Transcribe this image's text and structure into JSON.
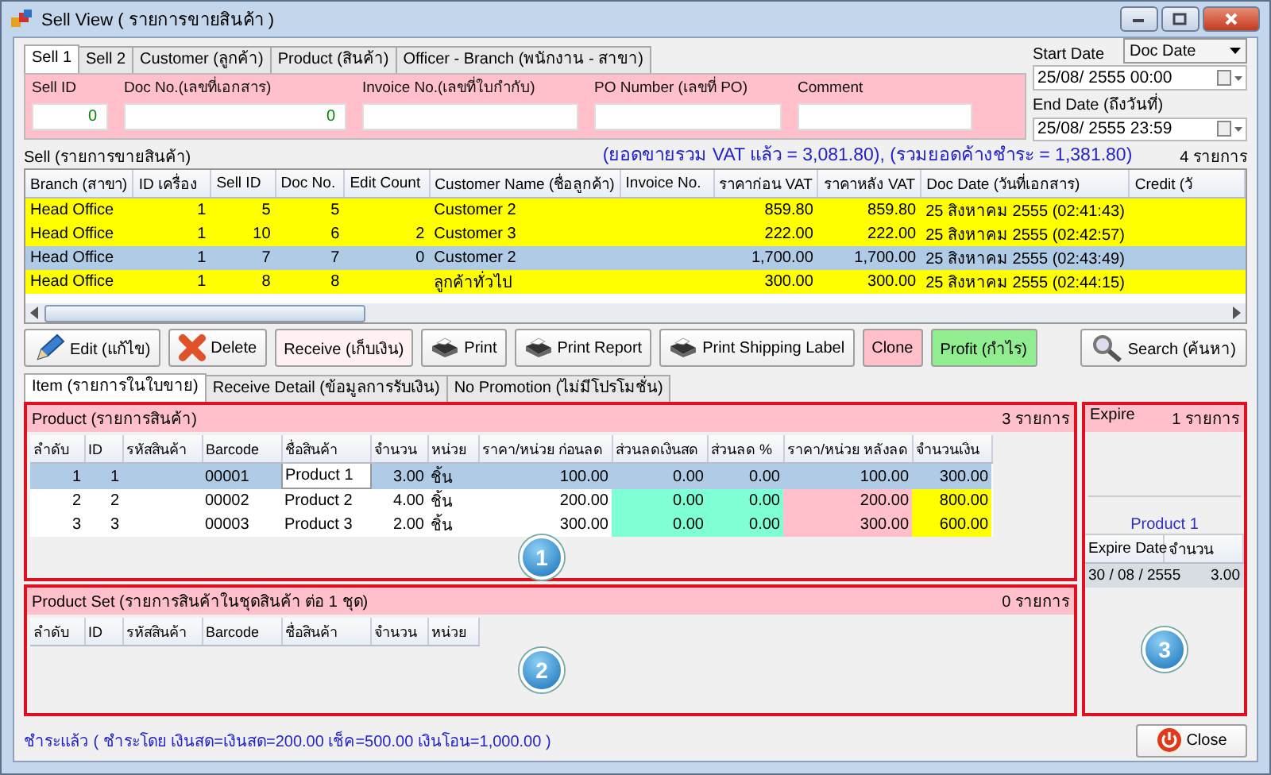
{
  "window": {
    "title": "Sell View ( รายการขายสินค้า )"
  },
  "tabs": [
    {
      "label": "Sell 1",
      "selected": true
    },
    {
      "label": "Sell 2",
      "selected": false
    },
    {
      "label": "Customer (ลูกค้า)",
      "selected": false
    },
    {
      "label": "Product (สินค้า)",
      "selected": false
    },
    {
      "label": "Officer - Branch (พนักงาน - สาขา)",
      "selected": false
    }
  ],
  "fields": [
    {
      "label": "Sell ID",
      "value": "0"
    },
    {
      "label": "Doc No.(เลขที่เอกสาร)",
      "value": "0"
    },
    {
      "label": "Invoice No.(เลขที่ใบกำกับ)"
    },
    {
      "label": "PO Number (เลขที่ PO)"
    },
    {
      "label": "Comment"
    }
  ],
  "date_filter": {
    "start_label": "Start Date",
    "mode": "Doc Date",
    "start": "25/08/  2555 00:00",
    "end_label": "End Date (ถึงวันที่)",
    "end": "25/08/  2555 23:59"
  },
  "sell": {
    "title": "Sell (รายการขายสินค้า)",
    "summary": "(ยอดขายรวม VAT แล้ว = 3,081.80), (รวมยอดค้างชำระ = 1,381.80)",
    "count": "4 รายการ",
    "columns": [
      "Branch (สาขา)",
      "ID เครื่อง",
      "Sell ID",
      "Doc No.",
      "Edit Count",
      "Customer Name (ชื่อลูกค้า)",
      "Invoice No.",
      "ราคาก่อน VAT",
      "ราคาหลัง VAT",
      "Doc Date (วันที่เอกสาร)",
      "Credit (วั"
    ],
    "rows": [
      {
        "branch": "Head Office",
        "machine_id": "1",
        "sell_id": "5",
        "doc_no": "5",
        "customer": "Customer 2",
        "pre_vat": "859.80",
        "post_vat": "859.80",
        "doc_date": "25 สิงหาคม 2555 (02:41:43)",
        "selected": false
      },
      {
        "branch": "Head Office",
        "machine_id": "1",
        "sell_id": "10",
        "doc_no": "6",
        "edit_count": "2",
        "customer": "Customer 3",
        "pre_vat": "222.00",
        "post_vat": "222.00",
        "doc_date": "25 สิงหาคม 2555 (02:42:57)",
        "selected": false
      },
      {
        "branch": "Head Office",
        "machine_id": "1",
        "sell_id": "7",
        "doc_no": "7",
        "edit_count": "0",
        "customer": "Customer 2",
        "pre_vat": "1,700.00",
        "post_vat": "1,700.00",
        "doc_date": "25 สิงหาคม 2555 (02:43:49)",
        "selected": true
      },
      {
        "branch": "Head Office",
        "machine_id": "1",
        "sell_id": "8",
        "doc_no": "8",
        "customer": "ลูกค้าทั่วไป",
        "pre_vat": "300.00",
        "post_vat": "300.00",
        "doc_date": "25 สิงหาคม 2555 (02:44:15)",
        "selected": false
      }
    ]
  },
  "buttons": [
    {
      "label": "Edit (แก้ไข)",
      "kind": "pencil"
    },
    {
      "label": "Delete",
      "kind": "cross"
    },
    {
      "label": "Receive (เก็บเงิน)",
      "kind": "plain"
    },
    {
      "label": "Print",
      "kind": "printer"
    },
    {
      "label": "Print Report",
      "kind": "printer"
    },
    {
      "label": "Print Shipping Label",
      "kind": "printer"
    },
    {
      "label": "Clone",
      "kind": "pink"
    },
    {
      "label": "Profit (กำไร)",
      "kind": "green"
    },
    {
      "label": "Search (ค้นหา)",
      "kind": "magnifier"
    }
  ],
  "detail_tabs": [
    {
      "label": "Item (รายการในใบขาย)",
      "selected": true
    },
    {
      "label": "Receive Detail (ข้อมูลการรับเงิน)",
      "selected": false
    },
    {
      "label": "No Promotion (ไม่มีโปรโมชั่น)",
      "selected": false
    }
  ],
  "product": {
    "title": "Product (รายการสินค้า)",
    "count": "3 รายการ",
    "marker": "1",
    "columns": [
      "ลำดับ",
      "ID",
      "รหัสสินค้า",
      "Barcode",
      "ชื่อสินค้า",
      "จำนวน",
      "หน่วย",
      "ราคา/หน่วย ก่อนลด",
      "ส่วนลดเงินสด",
      "ส่วนลด %",
      "ราคา/หน่วย หลังลด",
      "จำนวนเงิน"
    ],
    "rows": [
      {
        "no": "1",
        "id": "1",
        "barcode": "00001",
        "name": "Product 1",
        "qty": "3.00",
        "unit": "ชิ้น",
        "price": "100.00",
        "cash_discount": "0.00",
        "pct_discount": "0.00",
        "net_price": "100.00",
        "amount": "300.00",
        "selected": true
      },
      {
        "no": "2",
        "id": "2",
        "barcode": "00002",
        "name": "Product 2",
        "qty": "4.00",
        "unit": "ชิ้น",
        "price": "200.00",
        "cash_discount": "0.00",
        "pct_discount": "0.00",
        "net_price": "200.00",
        "amount": "800.00",
        "selected": false
      },
      {
        "no": "3",
        "id": "3",
        "barcode": "00003",
        "name": "Product 3",
        "qty": "2.00",
        "unit": "ชิ้น",
        "price": "300.00",
        "cash_discount": "0.00",
        "pct_discount": "0.00",
        "net_price": "300.00",
        "amount": "600.00",
        "selected": false
      }
    ]
  },
  "product_set": {
    "title": "Product Set (รายการสินค้าในชุดสินค้า ต่อ 1 ชุด)",
    "count": "0 รายการ",
    "marker": "2",
    "columns": [
      "ลำดับ",
      "ID",
      "รหัสสินค้า",
      "Barcode",
      "ชื่อสินค้า",
      "จำนวน",
      "หน่วย"
    ]
  },
  "expire": {
    "title": "Expire",
    "count": "1 รายการ",
    "product": "Product 1",
    "marker": "3",
    "columns": [
      "Expire Date",
      "จำนวน"
    ],
    "rows": [
      {
        "date": "30 / 08 / 2555",
        "qty": "3.00"
      }
    ]
  },
  "status": "ชำระแล้ว ( ชำระโดย เงินสด=เงินสด=200.00 เช็ค=500.00 เงินโอน=1,000.00 )",
  "close_button": "Close"
}
